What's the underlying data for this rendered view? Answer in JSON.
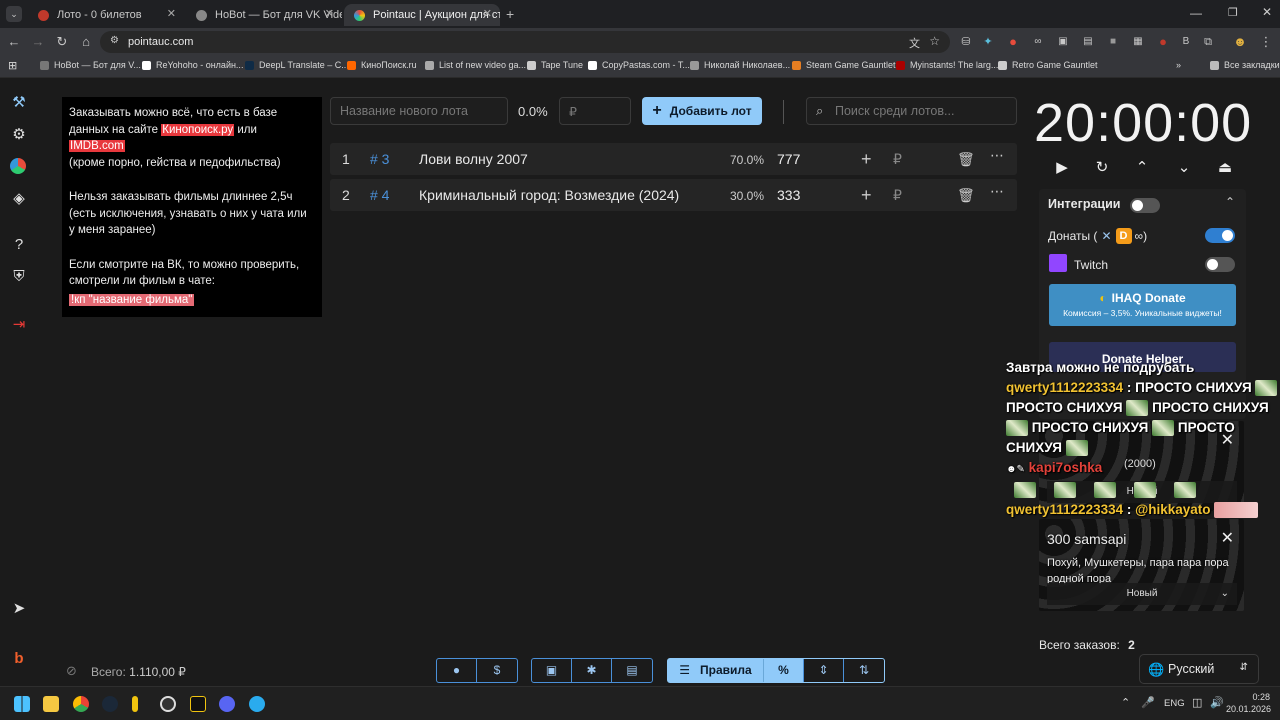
{
  "browser": {
    "tabs": [
      {
        "title": "Лото - 0 билетов"
      },
      {
        "title": "HoBot — Бот для VK Video Liv"
      },
      {
        "title": "Pointauc | Аукцион для стрим"
      }
    ],
    "url": "pointauc.com",
    "bookmarks": [
      "HoBot — Бот для V...",
      "ReYohoho - онлайн...",
      "DeepL Translate – C...",
      "КиноПоиск.ru",
      "List of new video ga...",
      "Tape Tune",
      "CopyPastas.com - T...",
      "Николай Николаев...",
      "Steam Game Gauntlet",
      "Myinstants! The larg...",
      "Retro Game Gauntlet"
    ],
    "all_bookmarks": "Все закладки"
  },
  "rules": {
    "p1_a": "Заказывать можно всё, что есть в базе данных на сайте ",
    "p1_link1": "Кинопоиск.ру",
    "p1_or": " или ",
    "p1_link2": "IMDB.com",
    "p1_b": "(кроме порно, гейства и педофильства)",
    "p2": "Нельзя заказывать фильмы длиннее 2,5ч (есть исключения, узнавать о них у чата или у меня заранее)",
    "p3": "Если смотрите на ВК, то можно проверить, смотрели ли фильм в чате:",
    "cmd": "!кп \"название фильма\""
  },
  "controls": {
    "new_lot_placeholder": "Название нового лота",
    "new_lot_percent": "0.0%",
    "amount_placeholder": "₽",
    "add_lot": "Добавить лот",
    "search_placeholder": "Поиск среди лотов..."
  },
  "lots": [
    {
      "num": "1",
      "id": "# 3",
      "name": "Лови волну 2007",
      "percent": "70.0%",
      "amount": "777"
    },
    {
      "num": "2",
      "id": "# 4",
      "name": "Криминальный город: Возмездие (2024)",
      "percent": "30.0%",
      "amount": "333"
    }
  ],
  "timer": "20:00:00",
  "integrations": {
    "title": "Интеграции",
    "donations_label": "Донаты (",
    "donations_close": ")",
    "twitch_label": "Twitch",
    "ihaq_title": "IHAQ Donate",
    "ihaq_sub": "Комиссия – 3,5%. Уникальные виджеты!",
    "donate_helper": "Donate Helper"
  },
  "chat": {
    "line1": "Завтра можно не подрубать",
    "user1": "qwerty1112223334",
    "msg1_words": [
      "ПРОСТО СНИХУЯ",
      "ПРОСТО СНИХУЯ",
      "ПРОСТО СНИХУЯ",
      "ПРОСТО СНИХУЯ",
      "ПРОСТО СНИХУЯ"
    ],
    "user2": "kapi7oshka",
    "user3": "qwerty1112223334",
    "msg3": "@hikkayato",
    "sep": " : "
  },
  "order_card1": {
    "close": "✕",
    "bg_text": "Новый",
    "partial": "(2000)"
  },
  "order_card2": {
    "title": "300 samsapi",
    "body": "Похуй, Мушкетеры, пара пара пора родной пора",
    "status": "Новый"
  },
  "orders_total_label": "Всего заказов:",
  "orders_total_value": "2",
  "total_label": "Всего:",
  "total_value": "1.110,00 ₽",
  "rules_button": "Правила",
  "language": "Русский",
  "tray": {
    "lang": "ENG",
    "time": "0:28",
    "date": "20.01.2026"
  }
}
